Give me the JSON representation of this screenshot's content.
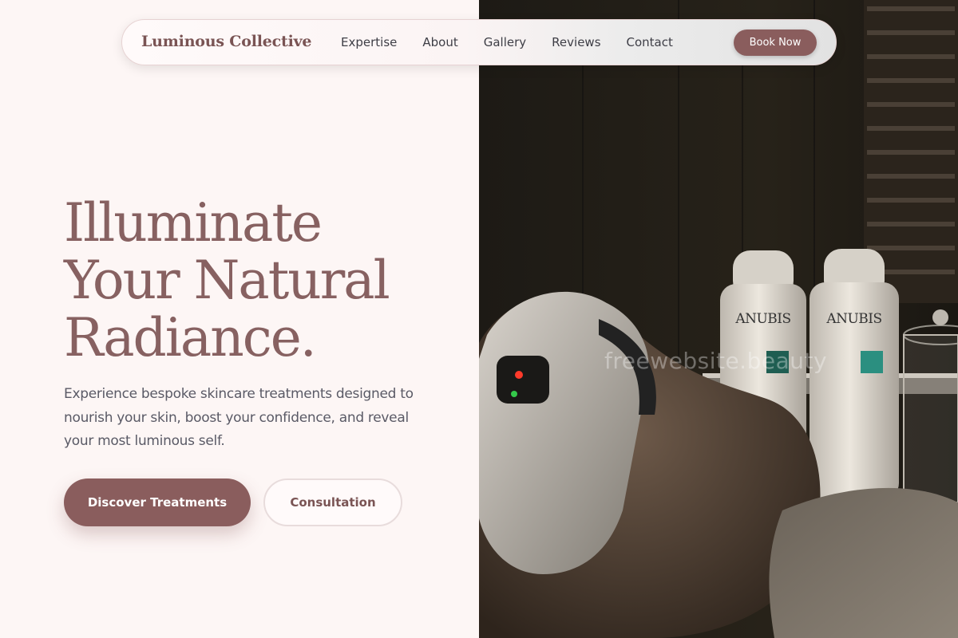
{
  "brand": {
    "name": "Luminous Collective"
  },
  "nav": {
    "items": [
      {
        "label": "Expertise"
      },
      {
        "label": "About"
      },
      {
        "label": "Gallery"
      },
      {
        "label": "Reviews"
      },
      {
        "label": "Contact"
      }
    ],
    "cta_label": "Book Now"
  },
  "hero": {
    "headline_lines": [
      "Illuminate",
      "Your Natural",
      "Radiance."
    ],
    "subtext": "Experience bespoke skincare treatments designed to nourish your skin, boost your confidence, and reveal your most luminous self.",
    "primary_button": "Discover Treatments",
    "secondary_button": "Consultation"
  },
  "image": {
    "product_label_left": "ANUBIS",
    "product_label_right": "ANUBIS",
    "watermark": "freewebsite.beauty"
  },
  "colors": {
    "accent": "#8a5d5d",
    "headline": "#876161",
    "background": "#fdf6f5"
  }
}
